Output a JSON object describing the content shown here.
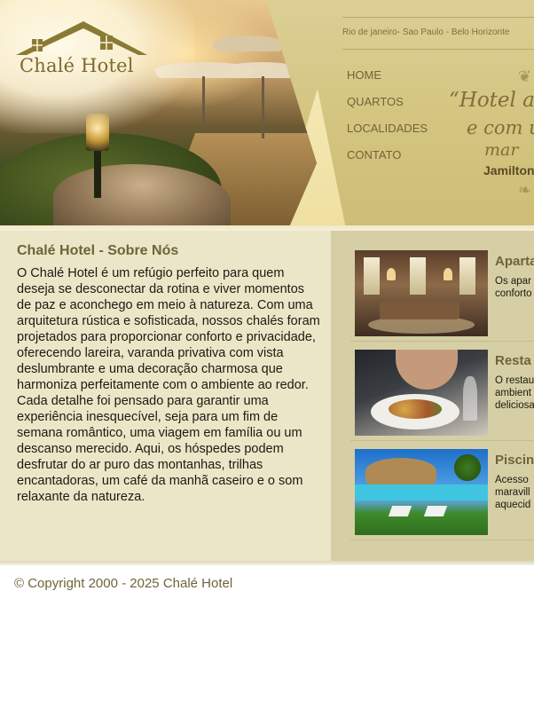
{
  "header": {
    "logo": {
      "brand": "Chalé Hotel"
    },
    "cities": "Rio de janeiro- Sao Paulo - Belo Horizonte",
    "nav": [
      "HOME",
      "QUARTOS",
      "LOCALIDADES",
      "CONTATO"
    ],
    "quote": {
      "line1": "“Hotel a",
      "line2": "e com u",
      "line3": "mar",
      "author": "Jamilton"
    }
  },
  "about": {
    "title": "Chalé Hotel - Sobre Nós",
    "text": "O Chalé Hotel é um refúgio perfeito para quem deseja se desconectar da rotina e viver momentos de paz e aconchego em meio à natureza. Com uma arquitetura rústica e sofisticada, nossos chalés foram projetados para proporcionar conforto e privacidade, oferecendo lareira, varanda privativa com vista deslumbrante e uma decoração charmosa que harmoniza perfeitamente com o ambiente ao redor. Cada detalhe foi pensado para garantir uma experiência inesquecível, seja para um fim de semana romântico, uma viagem em família ou um descanso merecido. Aqui, os hóspedes podem desfrutar do ar puro das montanhas, trilhas encantadoras, um café da manhã caseiro e o som relaxante da natureza."
  },
  "services": [
    {
      "title": "Aparta",
      "desc": "Os apar\nconforto"
    },
    {
      "title": "Resta",
      "desc": "O restau\nambient\ndeliciosa"
    },
    {
      "title": "Piscin",
      "desc": "Acesso\nmaravill\naquecid"
    }
  ],
  "footer": {
    "copyright": "© Copyright 2000 - 2025 Chalé Hotel"
  },
  "colors": {
    "gold": "#d6c98a",
    "text_olive": "#6f6438",
    "panel_light": "#ece6c8",
    "panel_dark": "#d6cfa5"
  }
}
